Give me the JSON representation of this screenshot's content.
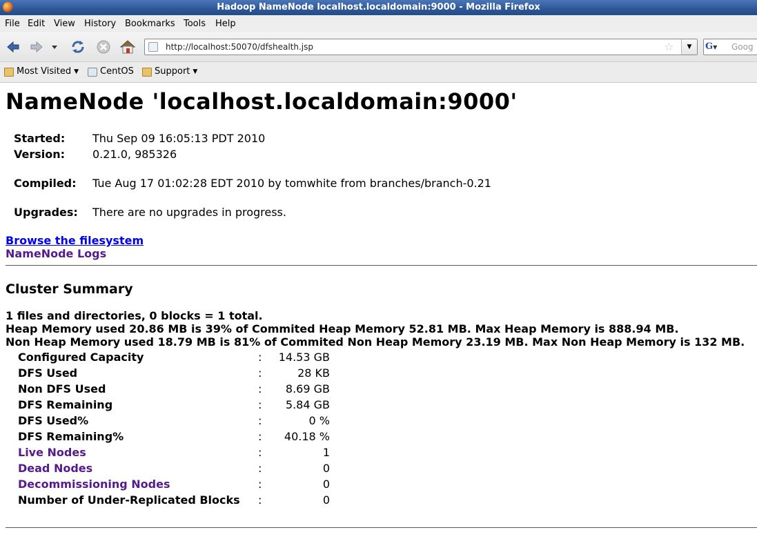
{
  "window": {
    "title": "Hadoop NameNode localhost.localdomain:9000 - Mozilla Firefox"
  },
  "menu": [
    {
      "label": "File"
    },
    {
      "label": "Edit"
    },
    {
      "label": "View"
    },
    {
      "label": "History"
    },
    {
      "label": "Bookmarks"
    },
    {
      "label": "Tools"
    },
    {
      "label": "Help"
    }
  ],
  "navigation": {
    "url": "http://localhost:50070/dfshealth.jsp",
    "search_placeholder": "Goog"
  },
  "bookmarks": [
    {
      "label": "Most Visited",
      "icon": "folder-icon"
    },
    {
      "label": "CentOS",
      "icon": "page-icon"
    },
    {
      "label": "Support",
      "icon": "folder-icon"
    }
  ],
  "page": {
    "title": "NameNode 'localhost.localdomain:9000'",
    "info": {
      "started_label": "Started:",
      "started": "Thu Sep 09 16:05:13 PDT 2010",
      "version_label": "Version:",
      "version": "0.21.0, 985326",
      "compiled_label": "Compiled:",
      "compiled": "Tue Aug 17 01:02:28 EDT 2010 by tomwhite from branches/branch-0.21",
      "upgrades_label": "Upgrades:",
      "upgrades": "There are no upgrades in progress."
    },
    "links": {
      "browse": "Browse the filesystem",
      "logs": "NameNode Logs"
    },
    "cluster_summary": {
      "heading": "Cluster Summary",
      "line1": "1 files and directories, 0 blocks = 1 total.",
      "line2": "Heap Memory used 20.86 MB is 39% of Commited Heap Memory 52.81 MB. Max Heap Memory is 888.94 MB.",
      "line3": "Non Heap Memory used 18.79 MB is 81% of Commited Non Heap Memory 23.19 MB. Max Non Heap Memory is 132 MB.",
      "rows": [
        {
          "label": "Configured Capacity",
          "value": "14.53 GB"
        },
        {
          "label": "DFS Used",
          "value": "28 KB"
        },
        {
          "label": "Non DFS Used",
          "value": "8.69 GB"
        },
        {
          "label": "DFS Remaining",
          "value": "5.84 GB"
        },
        {
          "label": "DFS Used%",
          "value": "0 %"
        },
        {
          "label": "DFS Remaining%",
          "value": "40.18 %"
        },
        {
          "label": "Live Nodes",
          "value": "1"
        },
        {
          "label": "Dead Nodes",
          "value": "0"
        },
        {
          "label": "Decommissioning Nodes",
          "value": "0"
        },
        {
          "label": "Number of Under-Replicated Blocks",
          "value": "0"
        }
      ],
      "separator": ":"
    }
  }
}
